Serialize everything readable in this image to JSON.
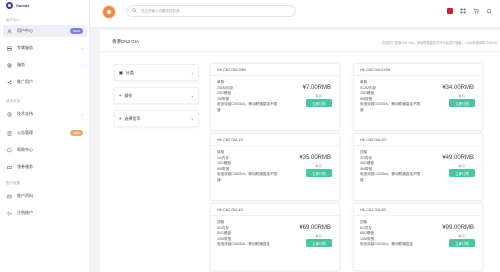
{
  "brand": {
    "name": "Gamde"
  },
  "sidebar": {
    "sections": [
      {
        "label": "用户中心"
      },
      {
        "label": "技术支持"
      },
      {
        "label": "账户设置"
      }
    ],
    "items": [
      {
        "label": "用户中心",
        "badge": "NEW",
        "badge_color": "#7b82d6",
        "icon": "user-icon",
        "active": true
      },
      {
        "label": "专属服务",
        "icon": "server-icon",
        "chevron": "›"
      },
      {
        "label": "服务",
        "icon": "globe-icon",
        "chevron": "›"
      },
      {
        "label": "推广用户",
        "icon": "share-icon"
      },
      {
        "label": "技术支持",
        "icon": "support-icon",
        "chevron": "›"
      },
      {
        "label": "公告管理",
        "badge": "NEW",
        "badge_color": "#f2a86c",
        "icon": "doc-icon"
      },
      {
        "label": "帮助中心",
        "icon": "help-icon"
      },
      {
        "label": "领券服务",
        "icon": "coupon-icon"
      },
      {
        "label": "账户资料",
        "icon": "profile-icon"
      },
      {
        "label": "注销账户",
        "icon": "logout-icon"
      }
    ]
  },
  "topbar": {
    "search_placeholder": "您正在输入问题寻找答案..."
  },
  "main": {
    "title": "香港CN2 GIA",
    "note": "您选择了香港CN2 GIA，移动联通直连方可大幅提升速度，Ceph存储保障CN2GIA"
  },
  "filters": [
    {
      "icon": "▣",
      "label": "分类",
      "chevron": "⌄"
    },
    {
      "icon": "+",
      "label": "操作",
      "chevron": "⌄"
    },
    {
      "icon": "+",
      "label": "选择货币",
      "chevron": "⌄"
    }
  ],
  "products": [
    {
      "name": "HK-CN2 GIA 2MB",
      "spec": [
        "单核",
        "256M内存",
        "20G硬盘",
        "2M带宽",
        "电信双链CN2GIA，移动联通直连不限速"
      ],
      "price": "¥7.00RMB",
      "cycle": "每月",
      "button": "立即订购"
    },
    {
      "name": "HK-CN2 GIA 512M",
      "spec": [
        "单核",
        "512M内存",
        "15G硬盘",
        "5M带宽",
        "电信双链CN2GIA，移动联通直连不限速"
      ],
      "price": "¥34.00RMB",
      "cycle": "每月",
      "button": "立即订购"
    },
    {
      "name": "HK-CN2 GIA 1G",
      "spec": [
        "双核",
        "1G内存",
        "10G硬盘",
        "5M带宽",
        "电信双链CN2GIA，移动联通直连不限速"
      ],
      "price": "¥35.00RMB",
      "cycle": "每月",
      "button": "立即订购"
    },
    {
      "name": "HK-CN2 GIA 2G",
      "spec": [
        "四核",
        "2G内存",
        "30G硬盘",
        "5M带宽",
        "电信双链CN2GIA，移动联通直连不限速"
      ],
      "price": "¥49.00RMB",
      "cycle": "每月",
      "button": "立即订购"
    },
    {
      "name": "HK-CN2 GIA 4G",
      "spec": [
        "四核",
        "4G内存",
        "50G硬盘",
        "10M带宽",
        "电信双链CN2GIA，移动联通直连"
      ],
      "price": "¥69.00RMB",
      "cycle": "每月",
      "button": "立即订购"
    },
    {
      "name": "HK-CN2 GIA 8G",
      "spec": [
        "四核",
        "8G内存",
        "80G硬盘",
        "15M带宽",
        "电信双链CN2GIA，移动联通直连"
      ],
      "price": "¥99.00RMB",
      "cycle": "每月",
      "button": "立即订购"
    }
  ]
}
